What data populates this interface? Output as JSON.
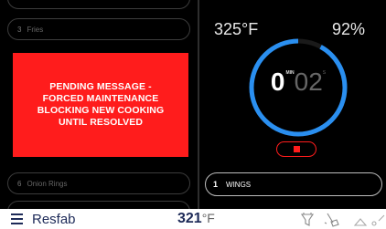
{
  "left_panel": {
    "slot_top": {
      "number": "3",
      "label": "Fries"
    },
    "slot_bottom": {
      "number": "6",
      "label": "Onion Rings"
    },
    "alert_message": "PENDING MESSAGE - FORCED MAINTENANCE BLOCKING NEW COOKING UNTIL RESOLVED",
    "alert_color": "#ff1c1c"
  },
  "right_panel": {
    "temperature": "325°F",
    "percent": "92%",
    "timer": {
      "minutes": "0",
      "minutes_label": "MIN",
      "seconds": "02",
      "seconds_label": "S"
    },
    "progress_fraction": 0.92,
    "ring_color": "#2a8ff0",
    "stop_color": "#ff1c1c",
    "product": {
      "number": "1",
      "label": "WINGS"
    }
  },
  "bottom_bar": {
    "brand": "Resfab",
    "temperature_value": "321",
    "temperature_unit": "°F",
    "icons": [
      "menu-icon",
      "filter-icon",
      "cleaning-icon",
      "notification-icon"
    ]
  }
}
